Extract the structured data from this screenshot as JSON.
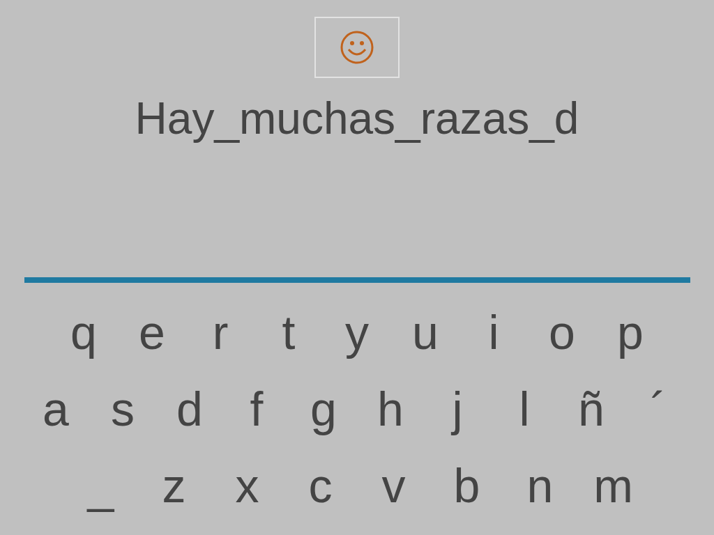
{
  "answer": {
    "text": "Hay_muchas_razas_d"
  },
  "keyboard": {
    "rows": [
      [
        "q",
        "e",
        "r",
        "t",
        "y",
        "u",
        "i",
        "o",
        "p"
      ],
      [
        "a",
        "s",
        "d",
        "f",
        "g",
        "h",
        "j",
        "l",
        "ñ",
        "´"
      ],
      [
        "_",
        "z",
        "x",
        "c",
        "v",
        "b",
        "n",
        "m"
      ]
    ]
  }
}
